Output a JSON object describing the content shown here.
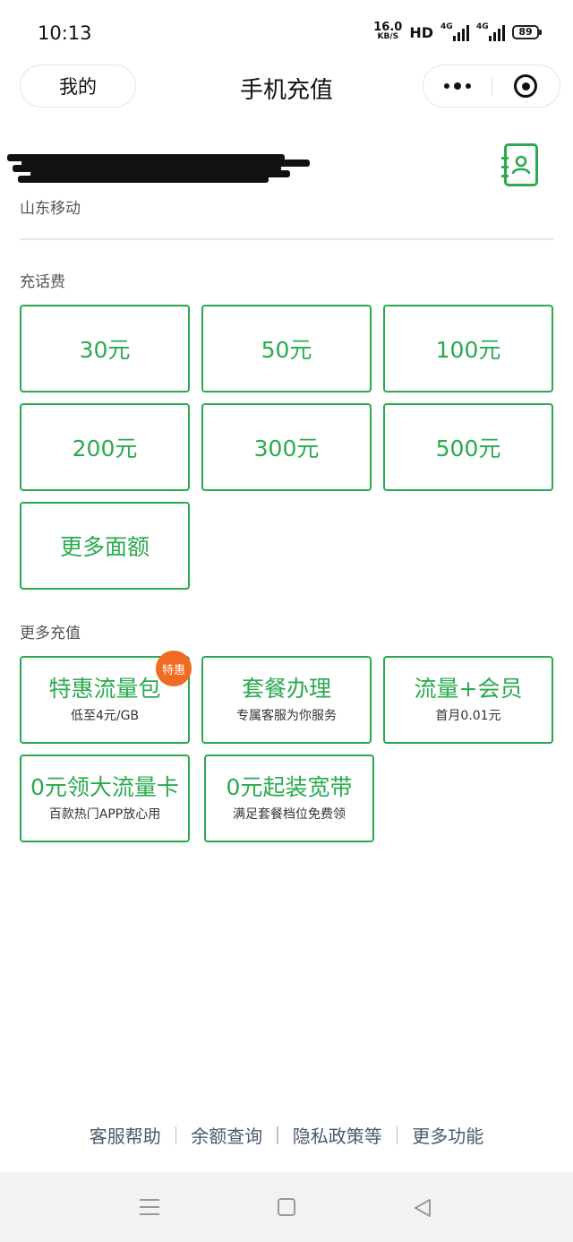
{
  "status_bar": {
    "time": "10:13",
    "net_speed_value": "16.0",
    "net_speed_unit": "KB/S",
    "hd": "HD",
    "sig1_label": "4G",
    "sig2_label": "4G",
    "battery": "89"
  },
  "nav": {
    "back_label": "我的",
    "title": "手机充值",
    "more_icon": "more-dots-icon",
    "close_icon": "target-close-icon"
  },
  "phone": {
    "carrier": "山东移动",
    "contact_icon": "contacts-book-icon"
  },
  "topup": {
    "label": "充话费",
    "amounts": [
      "30元",
      "50元",
      "100元",
      "200元",
      "300元",
      "500元"
    ],
    "more_label": "更多面额"
  },
  "more_recharge": {
    "label": "更多充值",
    "items": [
      {
        "title": "特惠流量包",
        "subtitle": "低至4元/GB",
        "badge": "特惠"
      },
      {
        "title": "套餐办理",
        "subtitle": "专属客服为你服务"
      },
      {
        "title": "流量+会员",
        "subtitle": "首月0.01元"
      },
      {
        "title": "0元领大流量卡",
        "subtitle": "百款热门APP放心用"
      },
      {
        "title": "0元起装宽带",
        "subtitle": "满足套餐档位免费领"
      }
    ]
  },
  "footer": {
    "links": [
      "客服帮助",
      "余额查询",
      "隐私政策等",
      "更多功能"
    ]
  },
  "colors": {
    "accent": "#2aaa4e",
    "badge": "#f06a22",
    "footer_link": "#4a5870"
  }
}
